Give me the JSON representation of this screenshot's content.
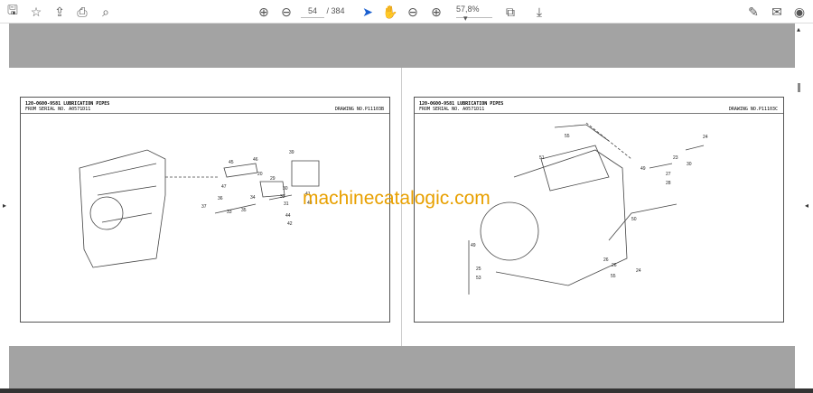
{
  "toolbar": {
    "current_page": "54",
    "total_pages": "/ 384",
    "zoom": "57,8%"
  },
  "watermark": "machinecatalogic.com",
  "pages": [
    {
      "title": "120-0600-9581 LUBRICATION PIPES",
      "serial": "FROM SERIAL NO. A0571D11",
      "drawing": "DRAWING NO.P11103B",
      "labels": [
        "45",
        "46",
        "47",
        "39",
        "20",
        "29",
        "30",
        "41",
        "43",
        "36",
        "34",
        "37",
        "33",
        "35",
        "32",
        "31",
        "44",
        "42"
      ]
    },
    {
      "title": "120-0600-9581 LUBRICATION PIPES",
      "serial": "FROM SERIAL NO. A0571D11",
      "drawing": "DRAWING NO.P11103C",
      "labels": [
        "55",
        "51",
        "24",
        "23",
        "30",
        "49",
        "27",
        "28",
        "50",
        "49",
        "25",
        "26",
        "26",
        "55",
        "24",
        "53"
      ]
    }
  ]
}
